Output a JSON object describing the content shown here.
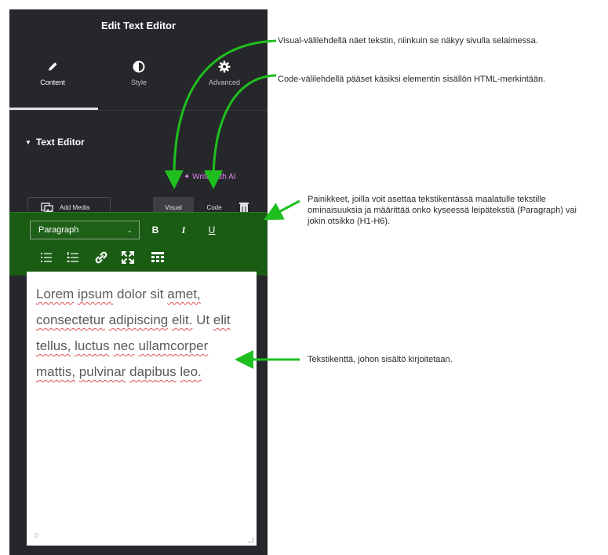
{
  "panel": {
    "title": "Edit Text Editor",
    "tabs": [
      {
        "label": "Content",
        "icon": "pencil-icon",
        "active": true
      },
      {
        "label": "Style",
        "icon": "contrast-icon",
        "active": false
      },
      {
        "label": "Advanced",
        "icon": "gear-icon",
        "active": false
      }
    ],
    "section_title": "Text Editor",
    "write_ai": "✦ Write with AI",
    "add_media": "Add Media",
    "mode_tabs": {
      "visual": "Visual",
      "code": "Code"
    },
    "toolbar": {
      "format_value": "Paragraph",
      "bold": "B",
      "italic": "I",
      "underline": "U"
    },
    "editor": {
      "words": [
        "Lorem",
        " ",
        "ipsum",
        " dolor sit ",
        "amet,",
        " ",
        "consectetur",
        " ",
        "adipiscing",
        " ",
        "elit.",
        " Ut ",
        "elit",
        " ",
        "tellus,",
        " ",
        "luctus",
        " ",
        "nec",
        " ",
        "ullamcorper",
        " ",
        "mattis,",
        " ",
        "pulvinar",
        " ",
        "dapibus",
        " ",
        "leo."
      ],
      "footer": "p"
    }
  },
  "annotations": {
    "visual": "Visual-välilehdellä näet tekstin, niinkuin se näkyy sivulla selaimessa.",
    "code": "Code-välilehdellä pääset käsiksi elementin sisällön HTML-merkintään.",
    "toolbar": "Painikkeet, joilla voit asettaa tekstikentässä maalatulle tekstille ominaisuuksia ja määrittää onko kyseessä leipätekstiä (Paragraph) vai jokin otsikko (H1-H6).",
    "editor": "Tekstikenttä, johon sisältö kirjoitetaan."
  },
  "colors": {
    "panel_bg": "#26272b",
    "toolbar_bg": "#1a5c14",
    "arrow": "#1fbf1f",
    "ai_accent": "#d785e8"
  }
}
